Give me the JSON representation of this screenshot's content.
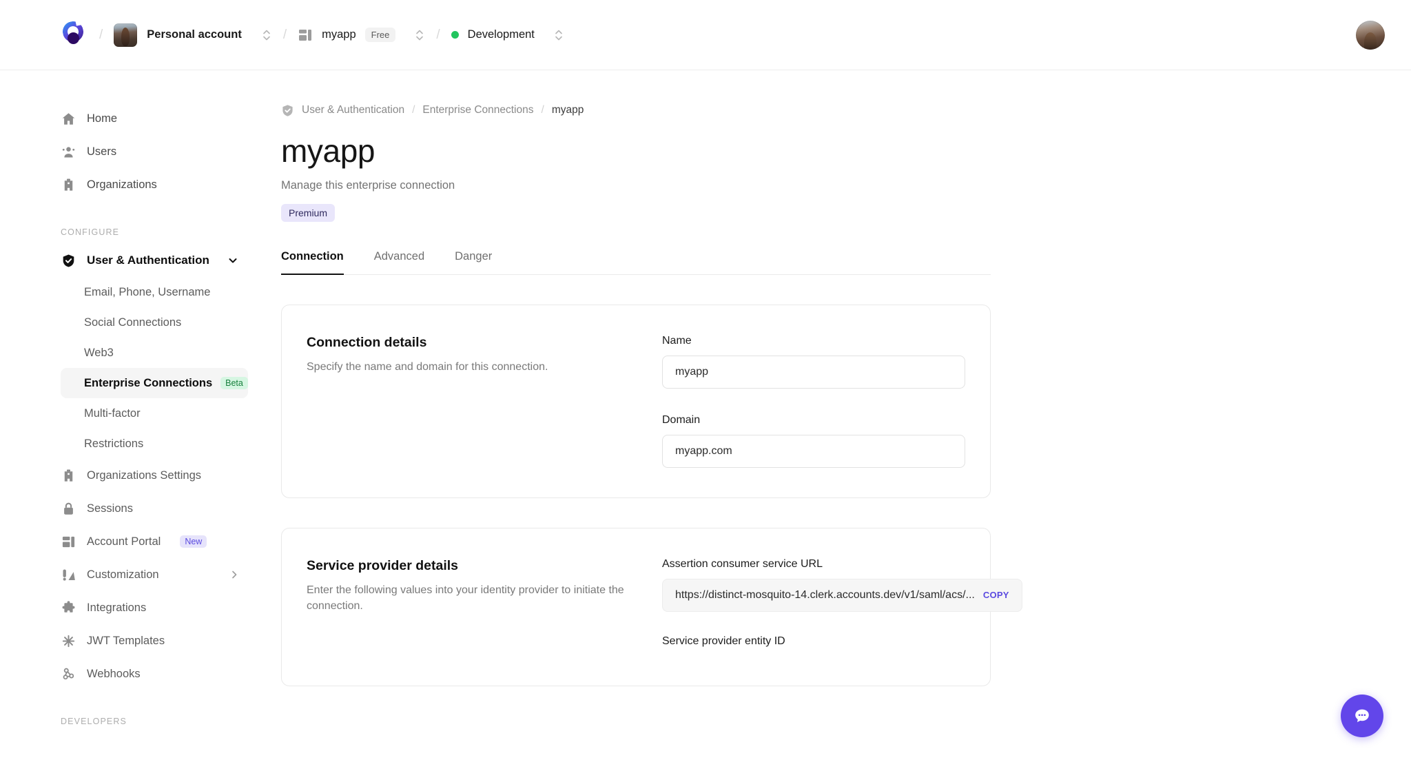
{
  "topbar": {
    "logo_icon": "clerk-logo-icon",
    "account": {
      "label": "Personal account",
      "avatar_icon": "account-avatar"
    },
    "app": {
      "label": "myapp",
      "plan_badge": "Free",
      "icon": "app-grid-icon"
    },
    "environment": {
      "label": "Development",
      "status_color": "#22c55e"
    },
    "user_avatar_icon": "user-avatar",
    "separator": "/"
  },
  "sidebar": {
    "top_items": [
      {
        "label": "Home",
        "icon": "home-icon"
      },
      {
        "label": "Users",
        "icon": "users-icon"
      },
      {
        "label": "Organizations",
        "icon": "organizations-icon"
      }
    ],
    "group_label": "CONFIGURE",
    "section": {
      "label": "User & Authentication",
      "icon": "shield-check-icon",
      "chevron": "chevron-down-icon"
    },
    "sub_items": [
      {
        "label": "Email, Phone, Username",
        "badge": "",
        "active": false
      },
      {
        "label": "Social Connections",
        "badge": "",
        "active": false
      },
      {
        "label": "Web3",
        "badge": "",
        "active": false
      },
      {
        "label": "Enterprise Connections",
        "badge": "Beta",
        "active": true
      },
      {
        "label": "Multi-factor",
        "badge": "",
        "active": false
      },
      {
        "label": "Restrictions",
        "badge": "",
        "active": false
      }
    ],
    "lower_items": [
      {
        "label": "Organizations Settings",
        "icon": "organizations-icon",
        "badge": "",
        "chevron": false
      },
      {
        "label": "Sessions",
        "icon": "lock-icon",
        "badge": "",
        "chevron": false
      },
      {
        "label": "Account Portal",
        "icon": "app-grid-icon",
        "badge": "New",
        "chevron": false
      },
      {
        "label": "Customization",
        "icon": "customization-icon",
        "badge": "",
        "chevron": true
      },
      {
        "label": "Integrations",
        "icon": "puzzle-icon",
        "badge": "",
        "chevron": false
      },
      {
        "label": "JWT Templates",
        "icon": "asterisk-icon",
        "badge": "",
        "chevron": false
      },
      {
        "label": "Webhooks",
        "icon": "webhooks-icon",
        "badge": "",
        "chevron": false
      }
    ],
    "developers_label": "DEVELOPERS"
  },
  "main": {
    "breadcrumb": {
      "icon": "shield-check-icon",
      "items": [
        "User & Authentication",
        "Enterprise Connections",
        "myapp"
      ],
      "separator": "/"
    },
    "title": "myapp",
    "subtitle": "Manage this enterprise connection",
    "premium_badge": "Premium",
    "tabs": [
      {
        "label": "Connection",
        "active": true
      },
      {
        "label": "Advanced",
        "active": false
      },
      {
        "label": "Danger",
        "active": false
      }
    ],
    "connection_card": {
      "title": "Connection details",
      "description": "Specify the name and domain for this connection.",
      "fields": [
        {
          "label": "Name",
          "value": "myapp"
        },
        {
          "label": "Domain",
          "value": "myapp.com"
        }
      ]
    },
    "service_card": {
      "title": "Service provider details",
      "description": "Enter the following values into your identity provider to initiate the connection.",
      "acs_label": "Assertion consumer service URL",
      "acs_value": "https://distinct-mosquito-14.clerk.accounts.dev/v1/saml/acs/...",
      "copy_label": "COPY",
      "entity_label": "Service provider entity ID"
    }
  },
  "chat": {
    "icon": "chat-bubble-icon",
    "color": "#6246ea"
  }
}
